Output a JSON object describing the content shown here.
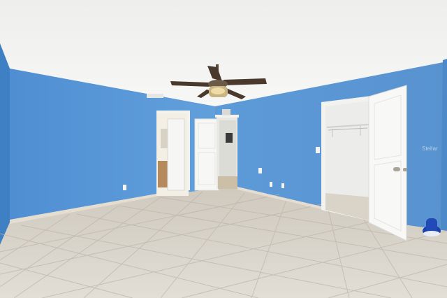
{
  "photo": {
    "subject": "",
    "watermark": "Stellar"
  },
  "colors": {
    "wall": "#5f9ad6",
    "ceiling": "#f2f2f0",
    "floor": "#d7d3cb",
    "door": "#f5f5f3",
    "closet_interior": "#efefec",
    "trim": "#ddd6c8"
  }
}
